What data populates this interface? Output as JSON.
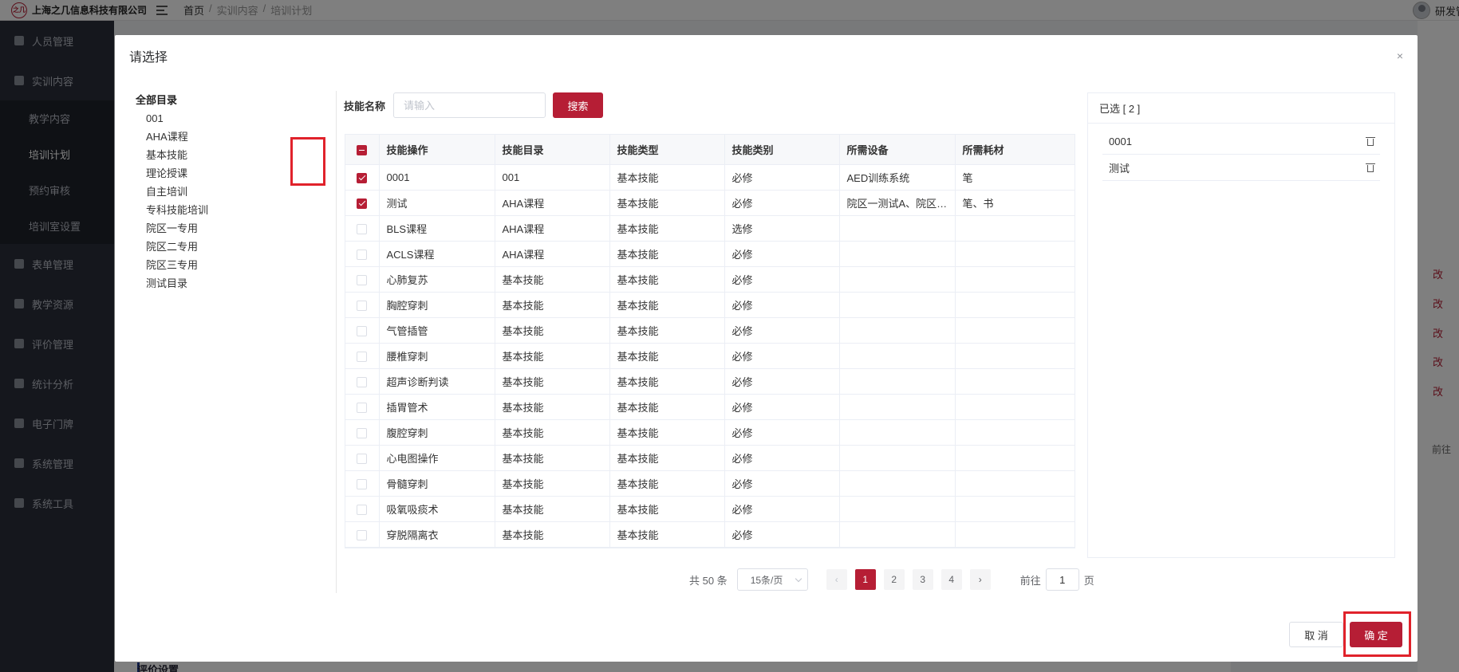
{
  "app": {
    "company": "上海之几信息科技有限公司",
    "logo_mark": "之几",
    "breadcrumb": [
      "首页",
      "实训内容",
      "培训计划"
    ],
    "breadcrumb_sep": "/",
    "user_name": "研发管理员"
  },
  "sidebar": {
    "items": [
      {
        "label": "人员管理"
      },
      {
        "label": "实训内容"
      },
      {
        "label": "教学内容"
      },
      {
        "label": "培训计划"
      },
      {
        "label": "预约审核"
      },
      {
        "label": "培训室设置"
      },
      {
        "label": "表单管理"
      },
      {
        "label": "教学资源"
      },
      {
        "label": "评价管理"
      },
      {
        "label": "统计分析"
      },
      {
        "label": "电子门牌"
      },
      {
        "label": "系统管理"
      },
      {
        "label": "系统工具"
      }
    ]
  },
  "background": {
    "edit_label": "改",
    "goto_label": "前往",
    "section_label": "评价设置"
  },
  "dialog": {
    "title": "请选择",
    "close_glyph": "×",
    "tree": {
      "root": "全部目录",
      "nodes": [
        "001",
        "AHA课程",
        "基本技能",
        "理论授课",
        "自主培训",
        "专科技能培训",
        "院区一专用",
        "院区二专用",
        "院区三专用",
        "测试目录"
      ]
    },
    "search": {
      "label": "技能名称",
      "placeholder": "请输入",
      "value": "",
      "button": "搜索"
    },
    "table": {
      "headers": [
        "技能操作",
        "技能目录",
        "技能类型",
        "技能类别",
        "所需设备",
        "所需耗材"
      ],
      "rows": [
        {
          "checked": true,
          "cells": [
            "0001",
            "001",
            "基本技能",
            "必修",
            "AED训练系统",
            "笔"
          ]
        },
        {
          "checked": true,
          "cells": [
            "测试",
            "AHA课程",
            "基本技能",
            "必修",
            "院区一测试A、院区…",
            "笔、书"
          ]
        },
        {
          "checked": false,
          "cells": [
            "BLS课程",
            "AHA课程",
            "基本技能",
            "选修",
            "",
            ""
          ]
        },
        {
          "checked": false,
          "cells": [
            "ACLS课程",
            "AHA课程",
            "基本技能",
            "必修",
            "",
            ""
          ]
        },
        {
          "checked": false,
          "cells": [
            "心肺复苏",
            "基本技能",
            "基本技能",
            "必修",
            "",
            ""
          ]
        },
        {
          "checked": false,
          "cells": [
            "胸腔穿刺",
            "基本技能",
            "基本技能",
            "必修",
            "",
            ""
          ]
        },
        {
          "checked": false,
          "cells": [
            "气管插管",
            "基本技能",
            "基本技能",
            "必修",
            "",
            ""
          ]
        },
        {
          "checked": false,
          "cells": [
            "腰椎穿刺",
            "基本技能",
            "基本技能",
            "必修",
            "",
            ""
          ]
        },
        {
          "checked": false,
          "cells": [
            "超声诊断判读",
            "基本技能",
            "基本技能",
            "必修",
            "",
            ""
          ]
        },
        {
          "checked": false,
          "cells": [
            "插胃管术",
            "基本技能",
            "基本技能",
            "必修",
            "",
            ""
          ]
        },
        {
          "checked": false,
          "cells": [
            "腹腔穿刺",
            "基本技能",
            "基本技能",
            "必修",
            "",
            ""
          ]
        },
        {
          "checked": false,
          "cells": [
            "心电图操作",
            "基本技能",
            "基本技能",
            "必修",
            "",
            ""
          ]
        },
        {
          "checked": false,
          "cells": [
            "骨髓穿刺",
            "基本技能",
            "基本技能",
            "必修",
            "",
            ""
          ]
        },
        {
          "checked": false,
          "cells": [
            "吸氧吸痰术",
            "基本技能",
            "基本技能",
            "必修",
            "",
            ""
          ]
        },
        {
          "checked": false,
          "cells": [
            "穿脱隔离衣",
            "基本技能",
            "基本技能",
            "必修",
            "",
            ""
          ]
        }
      ]
    },
    "pagination": {
      "total": "共 50 条",
      "page_size": "15条/页",
      "prev": "‹",
      "next": "›",
      "pages": [
        "1",
        "2",
        "3",
        "4"
      ],
      "current": "1",
      "goto_label": "前往",
      "goto_value": "1",
      "page_suffix": "页"
    },
    "selected": {
      "header": "已选 [ 2 ]",
      "items": [
        "0001",
        "测试"
      ]
    },
    "footer": {
      "cancel": "取 消",
      "confirm": "确 定"
    },
    "colors": {
      "accent": "#b61e35",
      "highlight": "#e0222b"
    }
  }
}
